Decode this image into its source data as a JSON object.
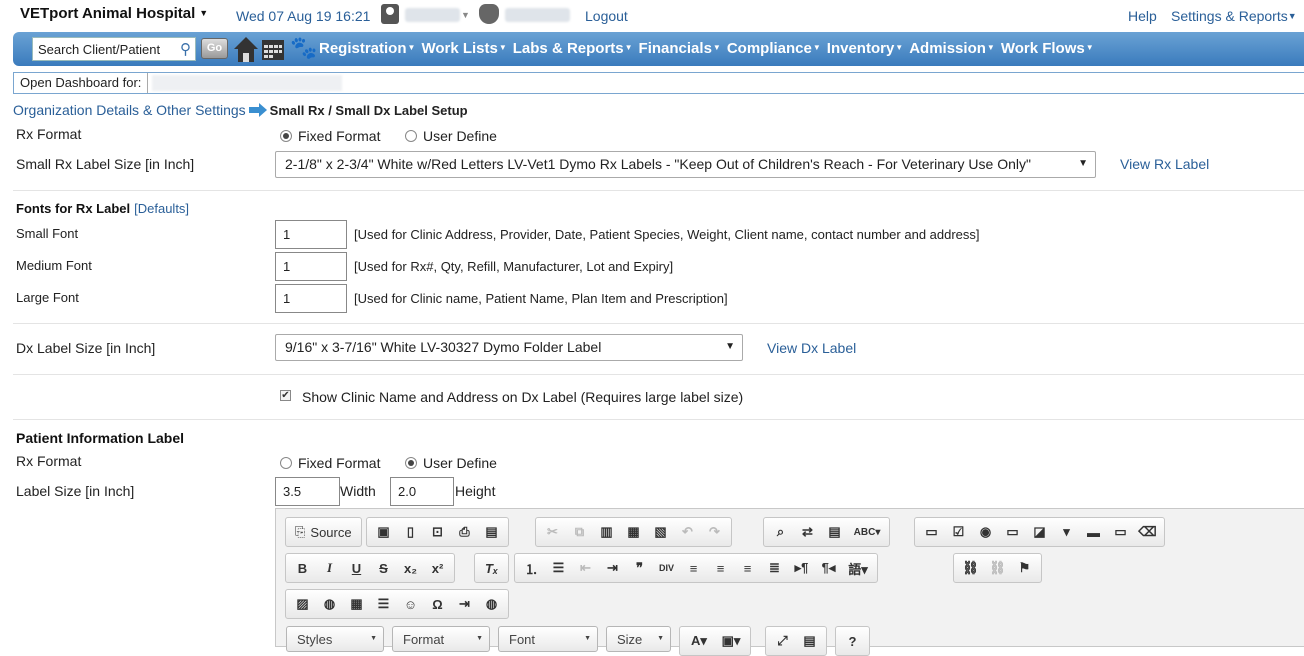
{
  "header": {
    "hospital": "VETport Animal Hospital",
    "datetime": "Wed 07 Aug 19 16:21",
    "logout": "Logout",
    "help": "Help",
    "settings": "Settings & Reports"
  },
  "nav": {
    "search_placeholder": "Search Client/Patient",
    "go": "Go",
    "menu": [
      "Registration",
      "Work Lists",
      "Labs & Reports",
      "Financials",
      "Compliance",
      "Inventory",
      "Admission",
      "Work Flows"
    ]
  },
  "dashboard": {
    "label": "Open Dashboard for:"
  },
  "breadcrumb": {
    "parent": "Organization Details & Other Settings",
    "current": "Small Rx / Small Dx Label Setup"
  },
  "rx_format": {
    "label": "Rx Format",
    "options": [
      "Fixed Format",
      "User Define"
    ],
    "selected": "Fixed Format"
  },
  "rx_label_size": {
    "label": "Small Rx Label Size [in Inch]",
    "value": "2-1/8\" x 2-3/4\" White w/Red Letters LV-Vet1 Dymo Rx Labels - \"Keep Out of Children's Reach - For Veterinary Use Only\"",
    "link": "View Rx Label"
  },
  "fonts": {
    "title": "Fonts for Rx Label",
    "defaults": "[Defaults]",
    "rows": [
      {
        "label": "Small Font",
        "value": "1",
        "note": "[Used for Clinic Address, Provider, Date, Patient Species, Weight, Client name, contact number and address]"
      },
      {
        "label": "Medium Font",
        "value": "1",
        "note": "[Used for Rx#, Qty, Refill, Manufacturer, Lot and Expiry]"
      },
      {
        "label": "Large Font",
        "value": "1",
        "note": "[Used for Clinic name, Patient Name, Plan Item and Prescription]"
      }
    ]
  },
  "dx_label": {
    "label": "Dx Label Size [in Inch]",
    "value": "9/16\" x 3-7/16\" White LV-30327 Dymo Folder Label",
    "link": "View Dx Label",
    "checkbox": "Show Clinic Name and Address on Dx Label (Requires large label size)",
    "checked": true
  },
  "patient_label": {
    "title": "Patient Information Label",
    "rx_format_label": "Rx Format",
    "options": [
      "Fixed Format",
      "User Define"
    ],
    "selected": "User Define",
    "size_label": "Label Size [in Inch]",
    "width": "3.5",
    "width_label": "Width",
    "height": "2.0",
    "height_label": "Height"
  },
  "editor": {
    "source": "Source",
    "combos": [
      "Styles",
      "Format",
      "Font",
      "Size"
    ]
  }
}
